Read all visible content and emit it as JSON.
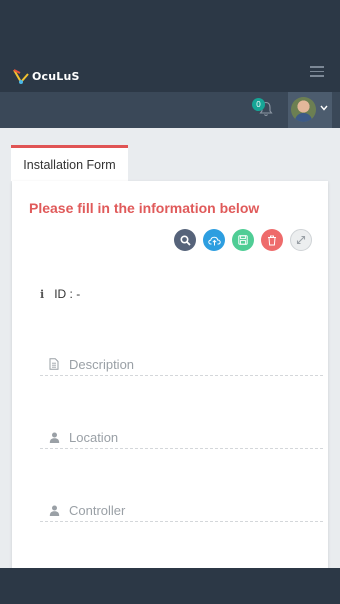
{
  "header": {
    "logo_text": "OcuLuS",
    "notification_count": "0"
  },
  "tab": {
    "label": "Installation Form"
  },
  "form": {
    "title": "Please fill in the information below",
    "id_label": "ID : -",
    "fields": [
      {
        "placeholder": "Description",
        "icon": "document-icon"
      },
      {
        "placeholder": "Location",
        "icon": "user-icon"
      },
      {
        "placeholder": "Controller",
        "icon": "user-icon"
      }
    ]
  },
  "actions": [
    "search-icon",
    "cloud-upload-icon",
    "save-icon",
    "trash-icon",
    "expand-icon"
  ],
  "colors": {
    "topbar": "#2c3846",
    "subbar": "#3a4858",
    "accent_red": "#e05454",
    "badge_teal": "#16a596"
  }
}
